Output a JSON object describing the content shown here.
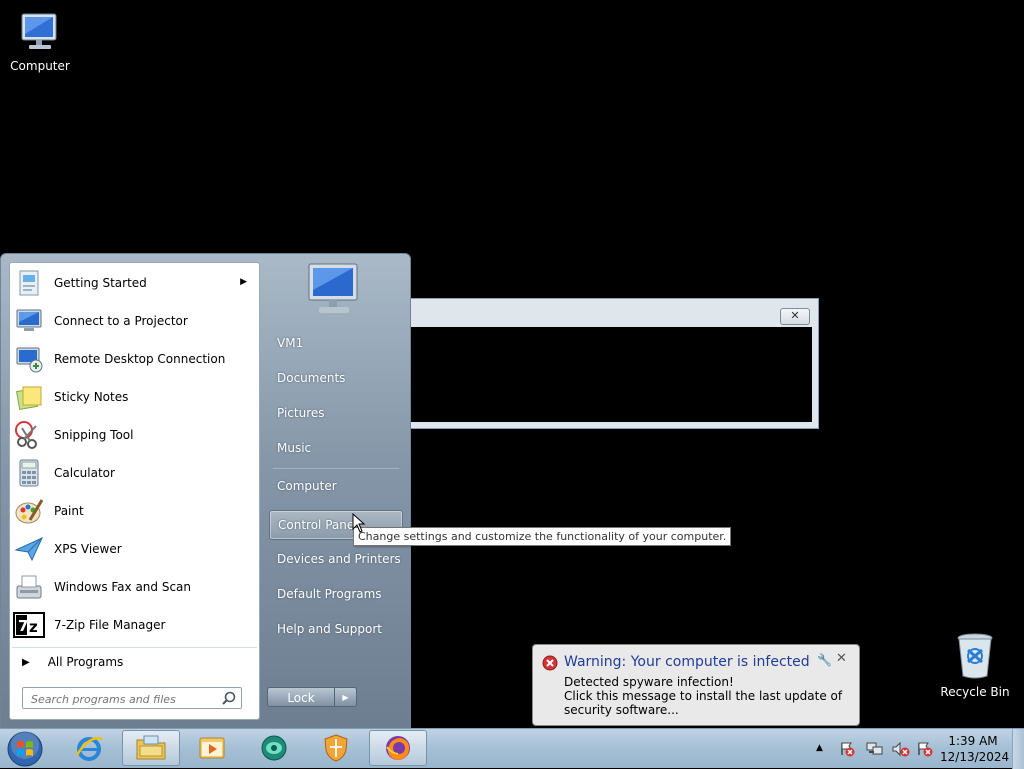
{
  "desktop": {
    "icons": [
      {
        "label": "Computer",
        "icon": "computer-icon"
      },
      {
        "label": "Recycle Bin",
        "icon": "recycle-bin-icon"
      }
    ]
  },
  "start_menu": {
    "programs": [
      {
        "label": "Getting Started",
        "icon": "getting-started-icon",
        "has_submenu": true
      },
      {
        "label": "Connect to a Projector",
        "icon": "projector-icon"
      },
      {
        "label": "Remote Desktop Connection",
        "icon": "remote-desktop-icon"
      },
      {
        "label": "Sticky Notes",
        "icon": "sticky-notes-icon"
      },
      {
        "label": "Snipping Tool",
        "icon": "snipping-tool-icon"
      },
      {
        "label": "Calculator",
        "icon": "calculator-icon"
      },
      {
        "label": "Paint",
        "icon": "paint-icon"
      },
      {
        "label": "XPS Viewer",
        "icon": "xps-viewer-icon"
      },
      {
        "label": "Windows Fax and Scan",
        "icon": "fax-scan-icon"
      },
      {
        "label": "7-Zip File Manager",
        "icon": "7zip-icon"
      }
    ],
    "all_programs": "All Programs",
    "search_placeholder": "Search programs and files",
    "right_items": [
      {
        "label": "VM1"
      },
      {
        "label": "Documents"
      },
      {
        "label": "Pictures"
      },
      {
        "label": "Music"
      },
      {
        "label": "Computer"
      },
      {
        "label": "Control Panel",
        "hovered": true
      },
      {
        "label": "Devices and Printers"
      },
      {
        "label": "Default Programs"
      },
      {
        "label": "Help and Support"
      }
    ],
    "lock_label": "Lock"
  },
  "tooltip": "Change settings and customize the functionality of your computer.",
  "notification": {
    "title": "Warning: Your computer is infected",
    "line1": "Detected spyware infection!",
    "line2": "Click this message to install the last update of security software...",
    "title_color": "#1f3d99"
  },
  "taskbar": {
    "pinned": [
      "internet-explorer-icon",
      "file-explorer-icon",
      "media-player-icon",
      "app-icon",
      "security-shield-icon",
      "firefox-icon"
    ],
    "time": "1:39 AM",
    "date": "12/13/2024"
  }
}
